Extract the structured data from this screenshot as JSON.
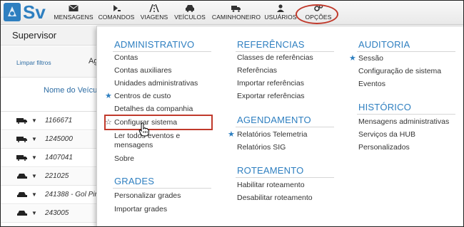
{
  "logo": {
    "text": "Sv"
  },
  "nav": [
    {
      "label": "MENSAGENS",
      "icon": "envelope-icon"
    },
    {
      "label": "COMANDOS",
      "icon": "command-icon"
    },
    {
      "label": "VIAGENS",
      "icon": "road-icon"
    },
    {
      "label": "VEÍCULOS",
      "icon": "car-icon"
    },
    {
      "label": "CAMINHONEIRO",
      "icon": "truck-icon"
    },
    {
      "label": "USUÁRIOS",
      "icon": "user-icon"
    },
    {
      "label": "OPÇÕES",
      "icon": "gears-icon"
    }
  ],
  "page": {
    "title": "Supervisor"
  },
  "filters": {
    "clear": "Limpar filtros",
    "partial": "Ag"
  },
  "table": {
    "column": "Nome do Veículo",
    "rows": [
      "1166671",
      "1245000",
      "1407041",
      "221025",
      "241388 - Gol Pir",
      "243005"
    ]
  },
  "bottom_partial": "...........  ......  ..........",
  "menu": {
    "administrativo": {
      "title": "ADMINISTRATIVO",
      "items": [
        "Contas",
        "Contas auxiliares",
        "Unidades administrativas",
        "Centros de custo",
        "Detalhes da companhia",
        "Configurar sistema",
        "Ler todos eventos e",
        "mensagens",
        "Sobre"
      ]
    },
    "grades": {
      "title": "GRADES",
      "items": [
        "Personalizar grades",
        "Importar grades"
      ]
    },
    "referencias": {
      "title": "REFERÊNCIAS",
      "items": [
        "Classes de referências",
        "Referências",
        "Importar referências",
        "Exportar referências"
      ]
    },
    "agendamento": {
      "title": "AGENDAMENTO",
      "items": [
        "Relatórios Telemetria",
        "Relatórios SIG"
      ]
    },
    "roteamento": {
      "title": "ROTEAMENTO",
      "items": [
        "Habilitar roteamento",
        "Desabilitar roteamento"
      ]
    },
    "auditoria": {
      "title": "AUDITORIA",
      "items": [
        "Sessão",
        "Configuração de sistema",
        "Eventos"
      ]
    },
    "historico": {
      "title": "HISTÓRICO",
      "items": [
        "Mensagens administrativas",
        "Serviços da HUB",
        "Personalizados"
      ]
    }
  },
  "colors": {
    "accent": "#2e7fc0",
    "highlight": "#c0392b"
  }
}
